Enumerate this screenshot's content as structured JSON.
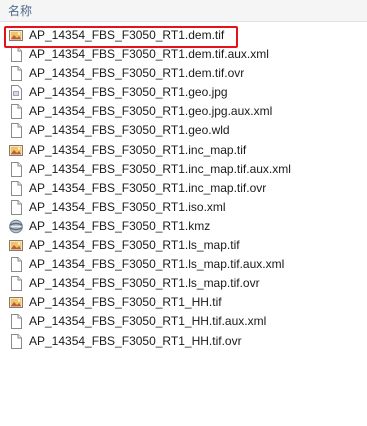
{
  "header": {
    "column_name": "名称"
  },
  "files": [
    {
      "name": "AP_14354_FBS_F3050_RT1.dem.tif",
      "icon": "tif-image-icon"
    },
    {
      "name": "AP_14354_FBS_F3050_RT1.dem.tif.aux.xml",
      "icon": "blank-file-icon"
    },
    {
      "name": "AP_14354_FBS_F3050_RT1.dem.tif.ovr",
      "icon": "blank-file-icon"
    },
    {
      "name": "AP_14354_FBS_F3050_RT1.geo.jpg",
      "icon": "jpg-image-icon"
    },
    {
      "name": "AP_14354_FBS_F3050_RT1.geo.jpg.aux.xml",
      "icon": "blank-file-icon"
    },
    {
      "name": "AP_14354_FBS_F3050_RT1.geo.wld",
      "icon": "blank-file-icon"
    },
    {
      "name": "AP_14354_FBS_F3050_RT1.inc_map.tif",
      "icon": "tif-image-icon"
    },
    {
      "name": "AP_14354_FBS_F3050_RT1.inc_map.tif.aux.xml",
      "icon": "blank-file-icon"
    },
    {
      "name": "AP_14354_FBS_F3050_RT1.inc_map.tif.ovr",
      "icon": "blank-file-icon"
    },
    {
      "name": "AP_14354_FBS_F3050_RT1.iso.xml",
      "icon": "blank-file-icon"
    },
    {
      "name": "AP_14354_FBS_F3050_RT1.kmz",
      "icon": "kmz-globe-icon"
    },
    {
      "name": "AP_14354_FBS_F3050_RT1.ls_map.tif",
      "icon": "tif-image-icon"
    },
    {
      "name": "AP_14354_FBS_F3050_RT1.ls_map.tif.aux.xml",
      "icon": "blank-file-icon"
    },
    {
      "name": "AP_14354_FBS_F3050_RT1.ls_map.tif.ovr",
      "icon": "blank-file-icon"
    },
    {
      "name": "AP_14354_FBS_F3050_RT1_HH.tif",
      "icon": "tif-image-icon"
    },
    {
      "name": "AP_14354_FBS_F3050_RT1_HH.tif.aux.xml",
      "icon": "blank-file-icon"
    },
    {
      "name": "AP_14354_FBS_F3050_RT1_HH.tif.ovr",
      "icon": "blank-file-icon"
    }
  ],
  "highlight_color": "#e4131a"
}
